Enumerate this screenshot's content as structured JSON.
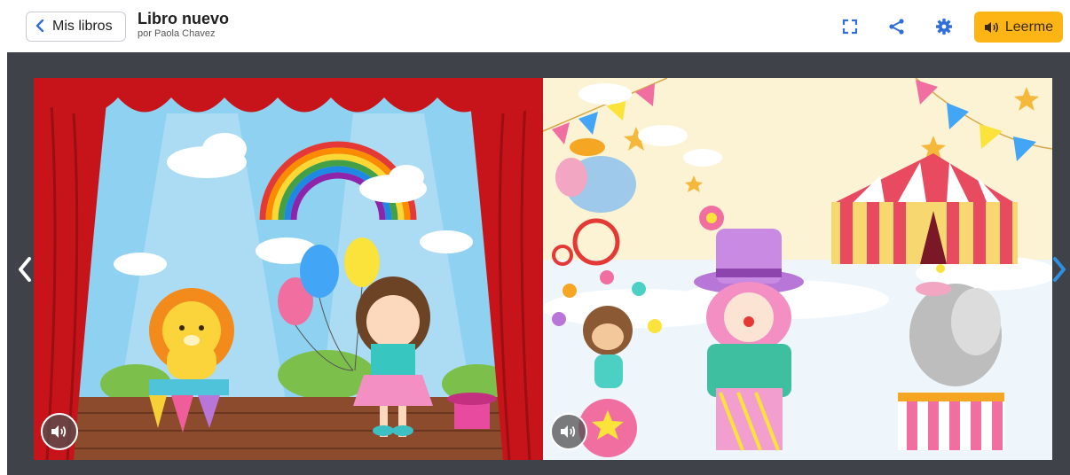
{
  "header": {
    "back_label": "Mis libros",
    "title": "Libro nuevo",
    "author": "por Paola Chavez",
    "read_label": "Leerme",
    "icons": {
      "back": "chevron-left-icon",
      "fullscreen": "fullscreen-icon",
      "share": "share-icon",
      "settings": "gear-icon",
      "read": "speaker-icon"
    },
    "colors": {
      "accent": "#2f6fd6",
      "read_button": "#fdb515"
    }
  },
  "reader": {
    "background": "#3f4248",
    "pages": [
      {
        "scene": "theater-stage-lion-girl",
        "audio_icon": "speaker-icon"
      },
      {
        "scene": "circus-clown-elephant-monkey",
        "audio_icon": "speaker-icon"
      }
    ],
    "nav": {
      "prev_icon": "chevron-left-icon",
      "next_icon": "chevron-right-icon"
    }
  }
}
